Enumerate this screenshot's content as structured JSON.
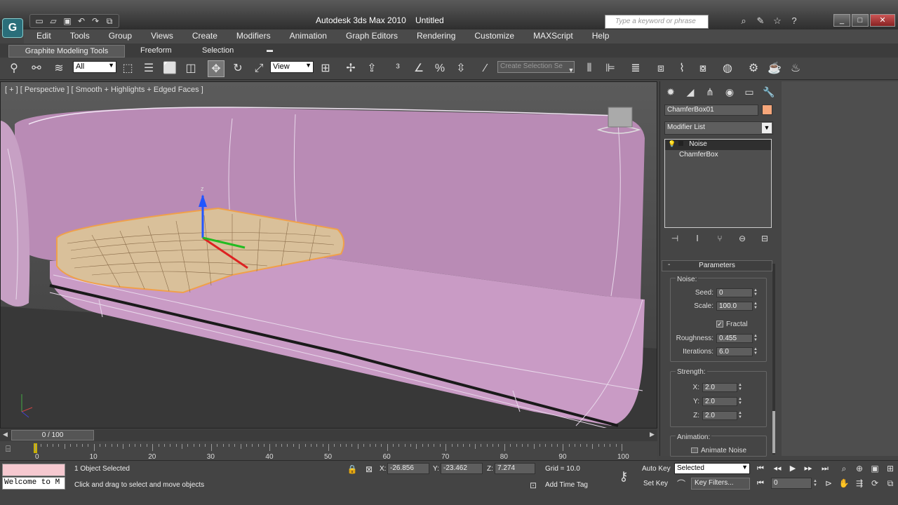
{
  "window": {
    "app_title": "Autodesk 3ds Max 2010",
    "doc_title": "Untitled",
    "search_placeholder": "Type a keyword or phrase"
  },
  "menu": [
    "Edit",
    "Tools",
    "Group",
    "Views",
    "Create",
    "Modifiers",
    "Animation",
    "Graph Editors",
    "Rendering",
    "Customize",
    "MAXScript",
    "Help"
  ],
  "ribbon_tabs": {
    "active": "Graphite Modeling Tools",
    "freeform": "Freeform",
    "selection": "Selection"
  },
  "toolbar": {
    "selection_filter": "All",
    "ref_coord": "View",
    "named_selection_placeholder": "Create Selection Se"
  },
  "viewport": {
    "label": "[ + ] [ Perspective ] [ Smooth + Highlights + Edged Faces ]",
    "gizmo_axis_z": "z"
  },
  "command_panel": {
    "object_name": "ChamferBox01",
    "object_color": "#f6a67a",
    "modifier_list_label": "Modifier List",
    "stack": [
      "Noise",
      "ChamferBox"
    ],
    "rollout_title": "Parameters",
    "noise_group": "Noise:",
    "seed_label": "Seed:",
    "seed_value": "0",
    "scale_label": "Scale:",
    "scale_value": "100.0",
    "fractal_label": "Fractal",
    "fractal_checked": true,
    "roughness_label": "Roughness:",
    "roughness_value": "0.455",
    "iterations_label": "Iterations:",
    "iterations_value": "6.0",
    "strength_group": "Strength:",
    "x_label": "X:",
    "x_value": "2.0",
    "y_label": "Y:",
    "y_value": "2.0",
    "z_label": "Z:",
    "z_value": "2.0",
    "animation_group": "Animation:",
    "animate_noise_label": "Animate Noise"
  },
  "timeline": {
    "slider_label": "0 / 100",
    "ticks": [
      "0",
      "10",
      "20",
      "30",
      "40",
      "50",
      "60",
      "70",
      "80",
      "90",
      "100"
    ]
  },
  "status": {
    "maxscript_text": "Welcome to M",
    "selection_status": "1 Object Selected",
    "prompt": "Click and drag to select and move objects",
    "x_label": "X:",
    "x_value": "-26.856",
    "y_label": "Y:",
    "y_value": "-23.462",
    "z_label": "Z:",
    "z_value": "7.274",
    "grid": "Grid = 10.0",
    "add_time_tag": "Add Time Tag",
    "auto_key": "Auto Key",
    "set_key": "Set Key",
    "key_mode": "Selected",
    "key_filters": "Key Filters...",
    "current_frame": "0"
  },
  "colors": {
    "pink_surface": "#c99bc5",
    "mesh_orange": "#f0a04a"
  }
}
